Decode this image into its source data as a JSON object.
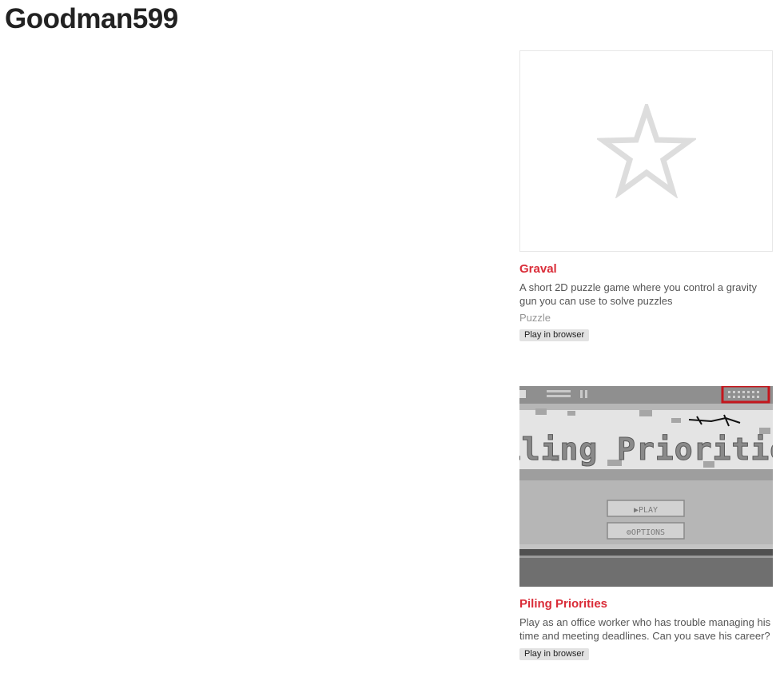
{
  "user": {
    "name": "Goodman599"
  },
  "games": [
    {
      "title": "Graval",
      "thumbnail_icon": "star-outline-icon",
      "description": "A short 2D puzzle game where you control a gravity gun you can use to solve puzzles",
      "genre": "Puzzle",
      "platform": "Play in browser"
    },
    {
      "title": "Piling Priorities",
      "thumbnail_icon": "game-cover-image",
      "cover": {
        "logo_text": "Piling Priorities",
        "play_label": "PLAY",
        "options_label": "OPTIONS"
      },
      "description": "Play as an office worker who has trouble managing his time and meeting deadlines. Can you save his career?",
      "platform": "Play in browser"
    }
  ],
  "colors": {
    "accent": "#da2c38",
    "badge_bg": "#e2e2e2",
    "placeholder_star": "#dddddd"
  }
}
